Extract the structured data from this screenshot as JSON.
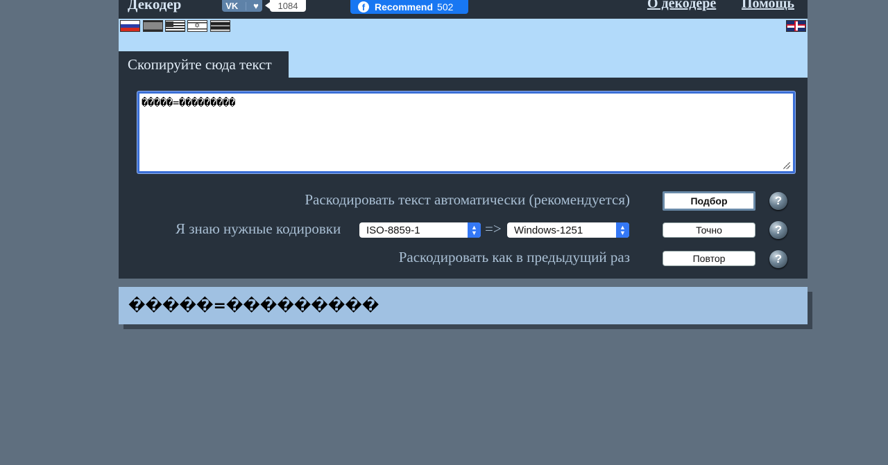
{
  "header": {
    "site_title": "Декодер",
    "vk_count": "1084",
    "fb_label": "Recommend",
    "fb_count": "502",
    "nav_about": "О декодере",
    "nav_help": "Помощь"
  },
  "flags": [
    "russian-flag-icon",
    "ukrainian-flag-icon",
    "greek-flag-icon",
    "israeli-flag-icon",
    "estonian-flag-icon",
    "uk-flag-icon"
  ],
  "tab": {
    "label": "Скопируйте сюда текст"
  },
  "input": {
    "value": "�����=���������"
  },
  "decode": {
    "auto_label": "Раскодировать текст автоматически (рекомендуется)",
    "auto_button": "Подбор",
    "manual_label": "Я знаю нужные кодировки",
    "from_encoding": "ISO-8859-1",
    "arrow": "=>",
    "to_encoding": "Windows-1251",
    "exact_button": "Точно",
    "repeat_label": "Раскодировать как в предыдущий раз",
    "repeat_button": "Повтор",
    "help_symbol": "?"
  },
  "result": {
    "text": "�����=���������"
  },
  "colors": {
    "background": "#5f6f7f",
    "panel": "#27313c",
    "flagbar": "#b2dafa",
    "result_bg": "#a0c1e2",
    "facebook": "#1877f2"
  }
}
